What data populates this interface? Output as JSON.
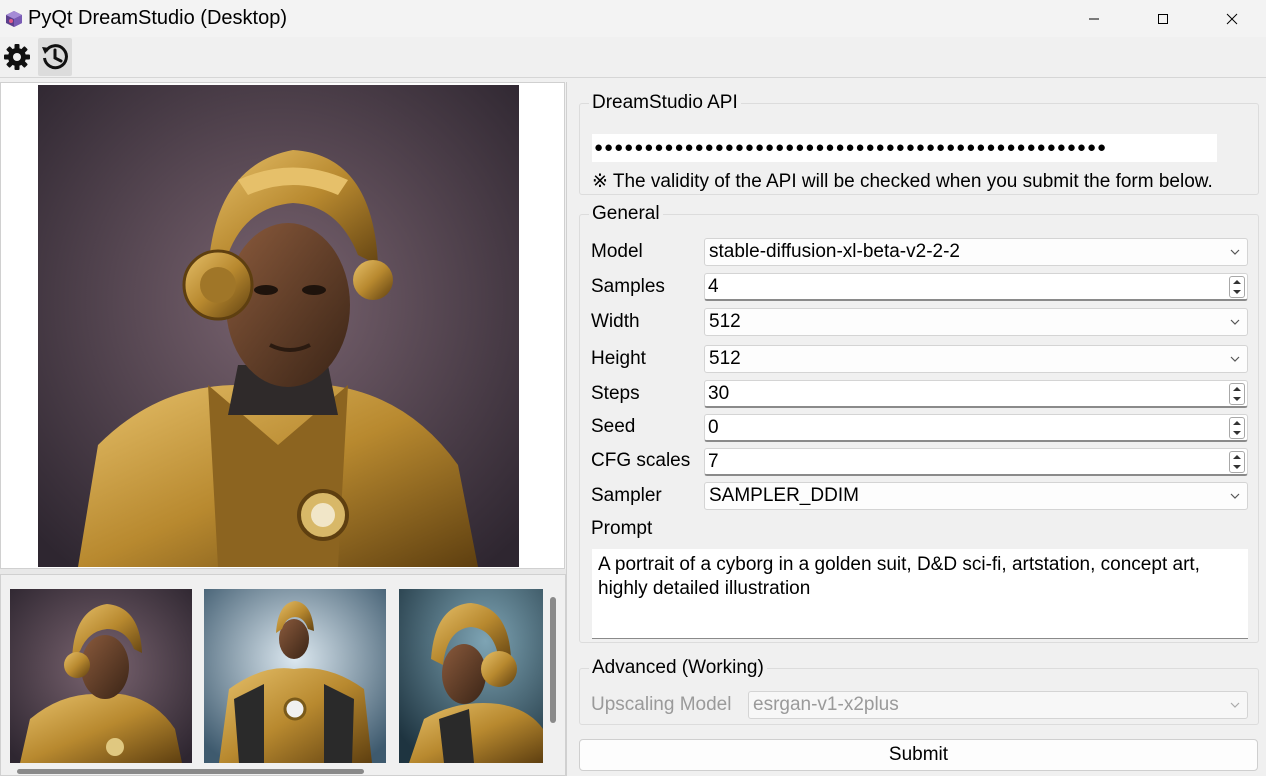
{
  "window": {
    "title": "PyQt DreamStudio (Desktop)"
  },
  "toolbar": {
    "settings_icon": "gear-icon",
    "history_icon": "history-icon"
  },
  "api_group": {
    "title": "DreamStudio API",
    "api_key_masked": "●●●●●●●●●●●●●●●●●●●●●●●●●●●●●●●●●●●●●●●●●●●●●●●●●●●",
    "note": "※ The validity of the API will be checked when you submit the form below."
  },
  "general_group": {
    "title": "General",
    "model": {
      "label": "Model",
      "value": "stable-diffusion-xl-beta-v2-2-2"
    },
    "samples": {
      "label": "Samples",
      "value": "4"
    },
    "width": {
      "label": "Width",
      "value": "512"
    },
    "height": {
      "label": "Height",
      "value": "512"
    },
    "steps": {
      "label": "Steps",
      "value": "30"
    },
    "seed": {
      "label": "Seed",
      "value": "0"
    },
    "cfg_scales": {
      "label": "CFG scales",
      "value": "7"
    },
    "sampler": {
      "label": "Sampler",
      "value": "SAMPLER_DDIM"
    },
    "prompt": {
      "label": "Prompt",
      "value": "A portrait of a cyborg in a golden suit, D&D sci-fi, artstation, concept art, highly detailed illustration"
    }
  },
  "advanced_group": {
    "title": "Advanced (Working)",
    "upscaling_model": {
      "label": "Upscaling Model",
      "value": "esrgan-v1-x2plus"
    }
  },
  "submit_label": "Submit",
  "colors": {
    "gold": "#b8892f",
    "gold_dark": "#6b4a14",
    "skin": "#5a3a26",
    "bg_portrait": "#4a3a44",
    "bg_blue": "#3e5a6e"
  }
}
